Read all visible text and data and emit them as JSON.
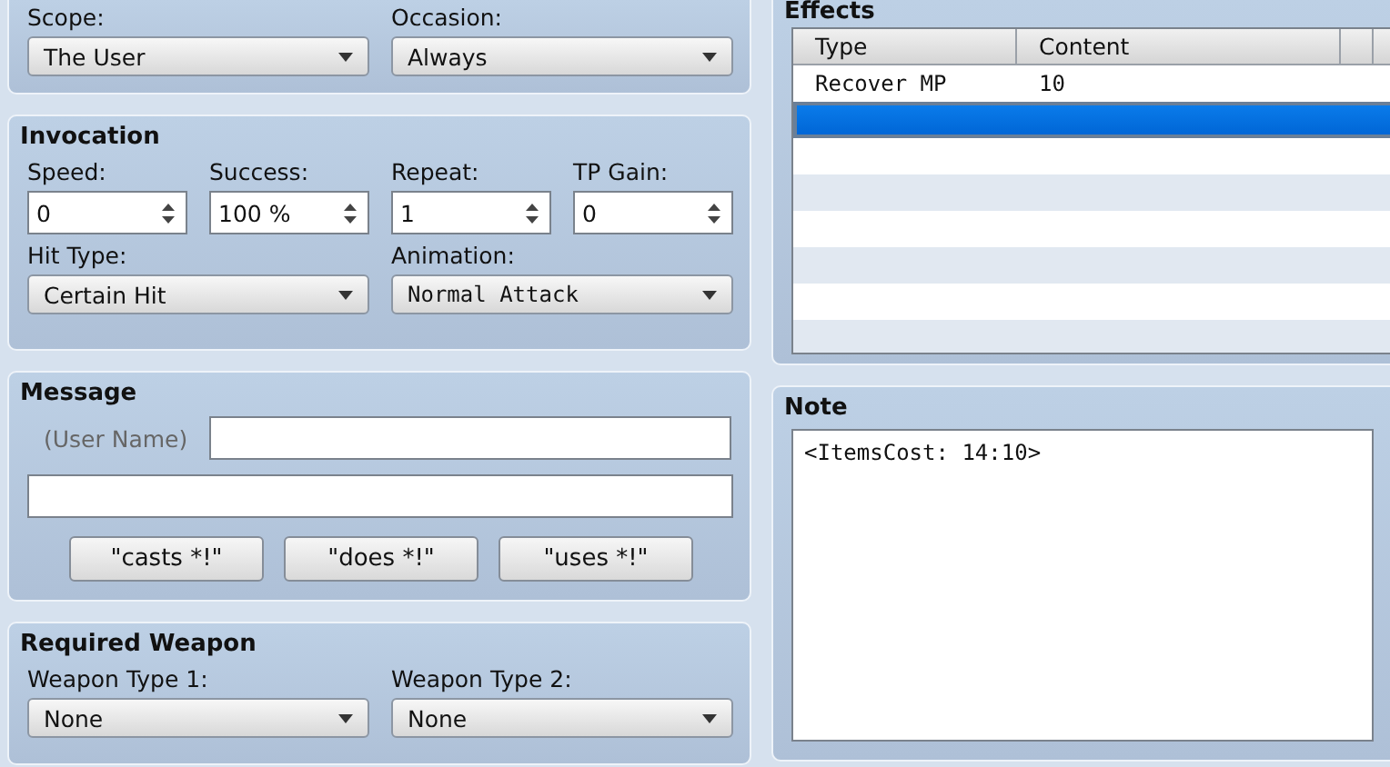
{
  "scope_panel": {
    "dropdowns": [
      {
        "label": "Scope:",
        "value": "The User"
      },
      {
        "label": "Occasion:",
        "value": "Always"
      }
    ]
  },
  "invocation": {
    "title": "Invocation",
    "spinners": [
      {
        "label": "Speed:",
        "value": "0"
      },
      {
        "label": "Success:",
        "value": "100 %"
      },
      {
        "label": "Repeat:",
        "value": "1"
      },
      {
        "label": "TP Gain:",
        "value": "0"
      }
    ],
    "dropdowns": [
      {
        "label": "Hit Type:",
        "value": "Certain Hit"
      },
      {
        "label": "Animation:",
        "value": "Normal Attack"
      }
    ]
  },
  "message": {
    "title": "Message",
    "user_name_label": "(User Name)",
    "buttons": [
      "\"casts *!\"",
      "\"does *!\"",
      "\"uses *!\""
    ]
  },
  "required_weapon": {
    "title": "Required Weapon",
    "dropdowns": [
      {
        "label": "Weapon Type 1:",
        "value": "None"
      },
      {
        "label": "Weapon Type 2:",
        "value": "None"
      }
    ]
  },
  "effects": {
    "title": "Effects",
    "columns": [
      "Type",
      "Content"
    ],
    "rows": [
      {
        "type": "Recover MP",
        "content": "10",
        "selected": false
      },
      {
        "selected": true
      }
    ]
  },
  "note": {
    "title": "Note",
    "value": "<ItemsCost: 14:10>"
  }
}
